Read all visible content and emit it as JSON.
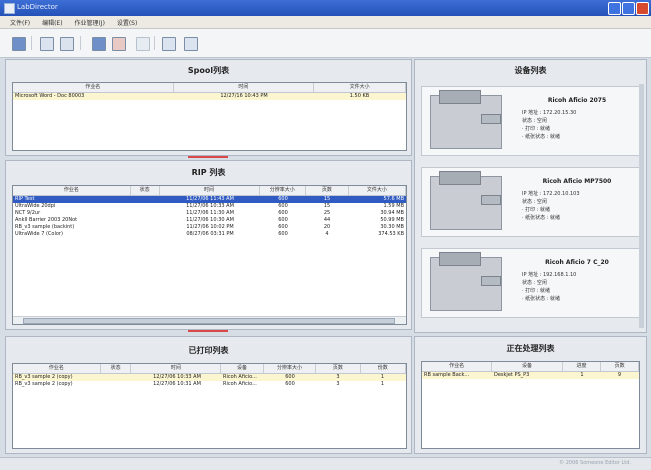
{
  "window": {
    "title": "LabDirector"
  },
  "menu": [
    "文件(F)",
    "编辑(E)",
    "作业管理(J)",
    "设置(S)"
  ],
  "toolbar": {
    "icons": [
      "print-icon",
      "folder-icon",
      "printer-icon",
      "document-icon",
      "hold-icon",
      "delete-icon",
      "info-icon",
      "settings-icon"
    ]
  },
  "spool": {
    "title": "Spool列表",
    "columns": [
      "作业名",
      "时间",
      "文件大小"
    ],
    "rows": [
      [
        "Microsoft Word - Doc 80003",
        "12/27/16 10:43 PM",
        "1.50 KB"
      ]
    ]
  },
  "rip": {
    "title": "RIP 列表",
    "columns": [
      "作业名",
      "状态",
      "时间",
      "分辨率大小",
      "页数",
      "文件大小"
    ],
    "rows": [
      [
        "RIP Test",
        "",
        "11/27/06 11:43 AM",
        "600",
        "15",
        "57.6 MB"
      ],
      [
        "UltraWide 20dpi",
        "",
        "11/27/06 10:33 AM",
        "600",
        "15",
        "1.59 MB"
      ],
      [
        "NCT 9/2ur",
        "",
        "11/27/06 11:30 AM",
        "600",
        "25",
        "30.94 MB"
      ],
      [
        "AnkII Barrier 2003 20Not",
        "",
        "11/27/06 10:30 AM",
        "600",
        "44",
        "50.99 MB"
      ],
      [
        "RB_v3 sample (backint)",
        "",
        "11/27/06 10:02 PM",
        "600",
        "20",
        "30.30 MB"
      ],
      [
        "UltraWide 7 (Color)",
        "",
        "08/27/06 03:31 PM",
        "600",
        "4",
        "374.53 KB"
      ]
    ]
  },
  "printed": {
    "title": "已打印列表",
    "columns": [
      "作业名",
      "状态",
      "时间",
      "设备",
      "分辨率大小",
      "页数",
      "份数"
    ],
    "rows": [
      [
        "RB_v3 sample 2 (copy)",
        "",
        "12/27/06 10:33 AM",
        "Ricoh Aficio...",
        "600",
        "3",
        "1"
      ],
      [
        "RB_v3 sample 2 (copy)",
        "",
        "12/27/06 10:31 AM",
        "Ricoh Aficio...",
        "600",
        "3",
        "1"
      ]
    ]
  },
  "devices": {
    "title": "设备列表",
    "items": [
      {
        "name": "Ricoh Aficio 2075",
        "ip": "IP 地址 : 172.20.15.30",
        "status": "状态 : 空闲",
        "s1": "· 打印 : 就绪",
        "s2": "· 纸张状态 : 就绪"
      },
      {
        "name": "Ricoh Aficio MP7500",
        "ip": "IP 地址 : 172.20.10.103",
        "status": "状态 : 空闲",
        "s1": "· 打印 : 就绪",
        "s2": "· 纸张状态 : 就绪"
      },
      {
        "name": "Ricoh Aficio 7 C_20",
        "ip": "IP 地址 : 192.168.1.10",
        "status": "状态 : 空闲",
        "s1": "· 打印 : 就绪",
        "s2": "· 纸张状态 : 就绪"
      }
    ]
  },
  "pending": {
    "title": "正在处理列表",
    "columns": [
      "作业名",
      "设备",
      "进度",
      "页数"
    ],
    "rows": [
      [
        "RB sample Back...",
        "Deskjet PS_P3",
        "1",
        "9"
      ]
    ]
  },
  "status": {
    "text": "© 2006 Someone Editor Ltd."
  }
}
